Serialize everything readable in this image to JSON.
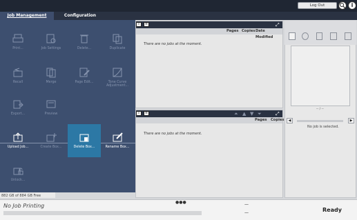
{
  "topbar": {
    "logout_label": "Log Out"
  },
  "tabs": [
    {
      "label": "Job Management"
    },
    {
      "label": "Configuration"
    }
  ],
  "left_panel": {
    "storage": "882 GB of 884 GB Free"
  },
  "job_list": {
    "columns": [
      "Pages",
      "Copies",
      "Date Modified"
    ],
    "empty_message": "There are no jobs at the moment."
  },
  "queue_list": {
    "columns": [
      "Pages",
      "Copies"
    ],
    "empty_message": "There are no jobs at the moment."
  },
  "right_panel": {
    "page_indicator": "-- / --",
    "dash": "--",
    "no_job": "No job is selected."
  },
  "menu": {
    "items": [
      {
        "label": "Print...",
        "icon": "print-icon",
        "enabled": false
      },
      {
        "label": "Job Settings",
        "icon": "job-settings-icon",
        "enabled": false
      },
      {
        "label": "Delete...",
        "icon": "trash-icon",
        "enabled": false
      },
      {
        "label": "Duplicate",
        "icon": "duplicate-icon",
        "enabled": false
      },
      {
        "label": "Recall",
        "icon": "recall-icon",
        "enabled": false
      },
      {
        "label": "Merge",
        "icon": "merge-icon",
        "enabled": false
      },
      {
        "label": "Page Edit...",
        "icon": "page-edit-icon",
        "enabled": false
      },
      {
        "label": "Tone Curve Adjustment...",
        "icon": "tone-curve-icon",
        "enabled": false
      },
      {
        "label": "Export...",
        "icon": "export-icon",
        "enabled": false
      },
      {
        "label": "Preview",
        "icon": "preview-icon",
        "enabled": false
      },
      {
        "label": "Upload Job...",
        "icon": "upload-job-icon",
        "enabled": true
      },
      {
        "label": "Create Box...",
        "icon": "create-box-icon",
        "enabled": false
      },
      {
        "label": "Delete Box...",
        "icon": "delete-box-icon",
        "enabled": true,
        "selected": true
      },
      {
        "label": "Rename Box...",
        "icon": "rename-box-icon",
        "enabled": true
      },
      {
        "label": "Unlock...",
        "icon": "unlock-icon",
        "enabled": false
      }
    ]
  },
  "status": {
    "printing": "No Job Printing",
    "ready": "Ready",
    "dash1": "—",
    "dash2": "—"
  },
  "colors": {
    "menu_bg": "#3d4f6f",
    "selected": "#2c78a5",
    "topbar": "#1f2633"
  }
}
